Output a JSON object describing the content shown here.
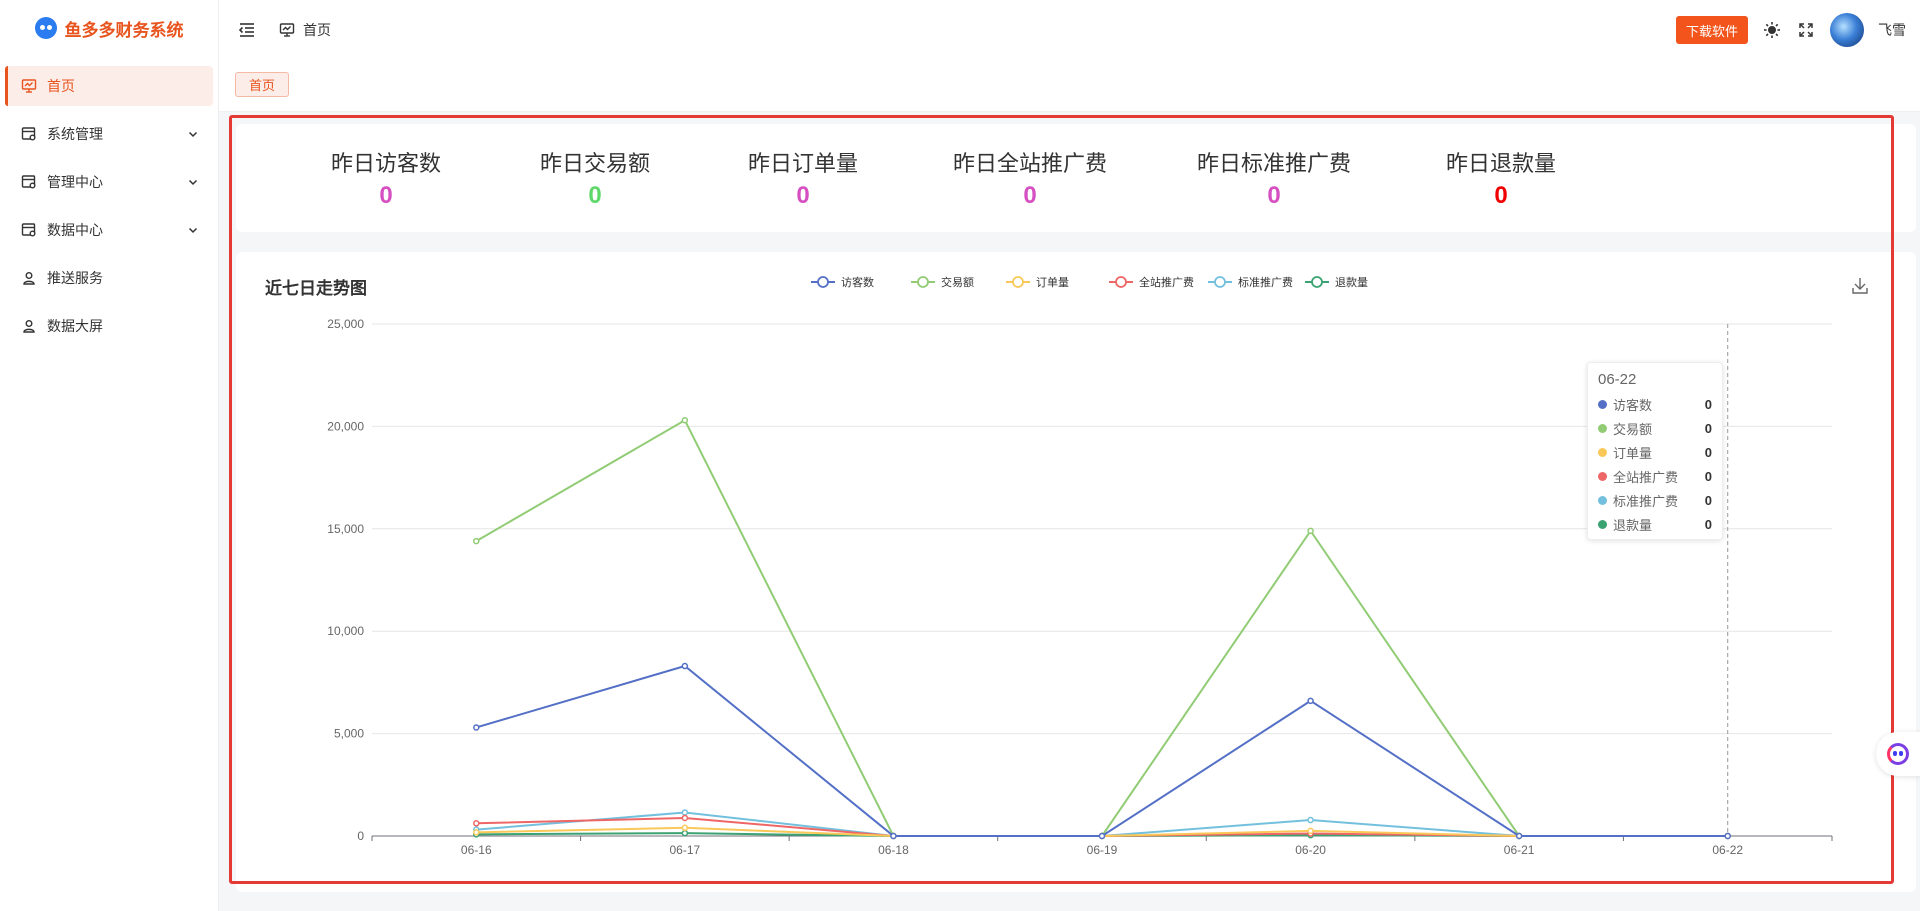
{
  "app": {
    "title": "鱼多多财务系统"
  },
  "sidebar": {
    "items": [
      {
        "label": "首页",
        "icon": "monitor-icon",
        "active": true,
        "expandable": false
      },
      {
        "label": "系统管理",
        "icon": "browser-gear-icon",
        "active": false,
        "expandable": true
      },
      {
        "label": "管理中心",
        "icon": "browser-gear-icon",
        "active": false,
        "expandable": true
      },
      {
        "label": "数据中心",
        "icon": "browser-gear-icon",
        "active": false,
        "expandable": true
      },
      {
        "label": "推送服务",
        "icon": "user-icon",
        "active": false,
        "expandable": false
      },
      {
        "label": "数据大屏",
        "icon": "user-icon",
        "active": false,
        "expandable": false
      }
    ]
  },
  "header": {
    "breadcrumb": "首页",
    "download_label": "下载软件",
    "username": "飞雪"
  },
  "tabs": [
    {
      "label": "首页",
      "active": true
    }
  ],
  "stats": [
    {
      "label": "昨日访客数",
      "value": "0",
      "color": "#d64fc2"
    },
    {
      "label": "昨日交易额",
      "value": "0",
      "color": "#5fd86a"
    },
    {
      "label": "昨日订单量",
      "value": "0",
      "color": "#d64fc2"
    },
    {
      "label": "昨日全站推广费",
      "value": "0",
      "color": "#d64fc2"
    },
    {
      "label": "昨日标准推广费",
      "value": "0",
      "color": "#d64fc2"
    },
    {
      "label": "昨日退款量",
      "value": "0",
      "color": "#f00000"
    }
  ],
  "chart_data": {
    "type": "line",
    "title": "近七日走势图",
    "categories": [
      "06-16",
      "06-17",
      "06-18",
      "06-19",
      "06-20",
      "06-21",
      "06-22"
    ],
    "ylim": [
      0,
      25000
    ],
    "yticks": [
      0,
      5000,
      10000,
      15000,
      20000,
      25000
    ],
    "ytick_labels": [
      "0",
      "5,000",
      "10,000",
      "15,000",
      "20,000",
      "25,000"
    ],
    "grid": true,
    "legend_position": "top-center",
    "series": [
      {
        "name": "访客数",
        "color": "#5470c6",
        "values": [
          5300,
          8300,
          0,
          0,
          6600,
          0,
          0
        ]
      },
      {
        "name": "交易额",
        "color": "#91cc75",
        "values": [
          14400,
          20300,
          0,
          0,
          14900,
          0,
          0
        ]
      },
      {
        "name": "订单量",
        "color": "#fac858",
        "values": [
          180,
          400,
          0,
          0,
          250,
          0,
          0
        ]
      },
      {
        "name": "全站推广费",
        "color": "#ee6666",
        "values": [
          620,
          880,
          0,
          0,
          120,
          0,
          0
        ]
      },
      {
        "name": "标准推广费",
        "color": "#73c0de",
        "values": [
          310,
          1150,
          0,
          0,
          780,
          0,
          0
        ]
      },
      {
        "name": "退款量",
        "color": "#3ba272",
        "values": [
          80,
          140,
          0,
          0,
          40,
          0,
          0
        ]
      }
    ],
    "tooltip": {
      "title": "06-22",
      "rows": [
        {
          "name": "访客数",
          "value": "0",
          "color": "#5470c6"
        },
        {
          "name": "交易额",
          "value": "0",
          "color": "#91cc75"
        },
        {
          "name": "订单量",
          "value": "0",
          "color": "#fac858"
        },
        {
          "name": "全站推广费",
          "value": "0",
          "color": "#ee6666"
        },
        {
          "name": "标准推广费",
          "value": "0",
          "color": "#73c0de"
        },
        {
          "name": "退款量",
          "value": "0",
          "color": "#3ba272"
        }
      ]
    }
  }
}
